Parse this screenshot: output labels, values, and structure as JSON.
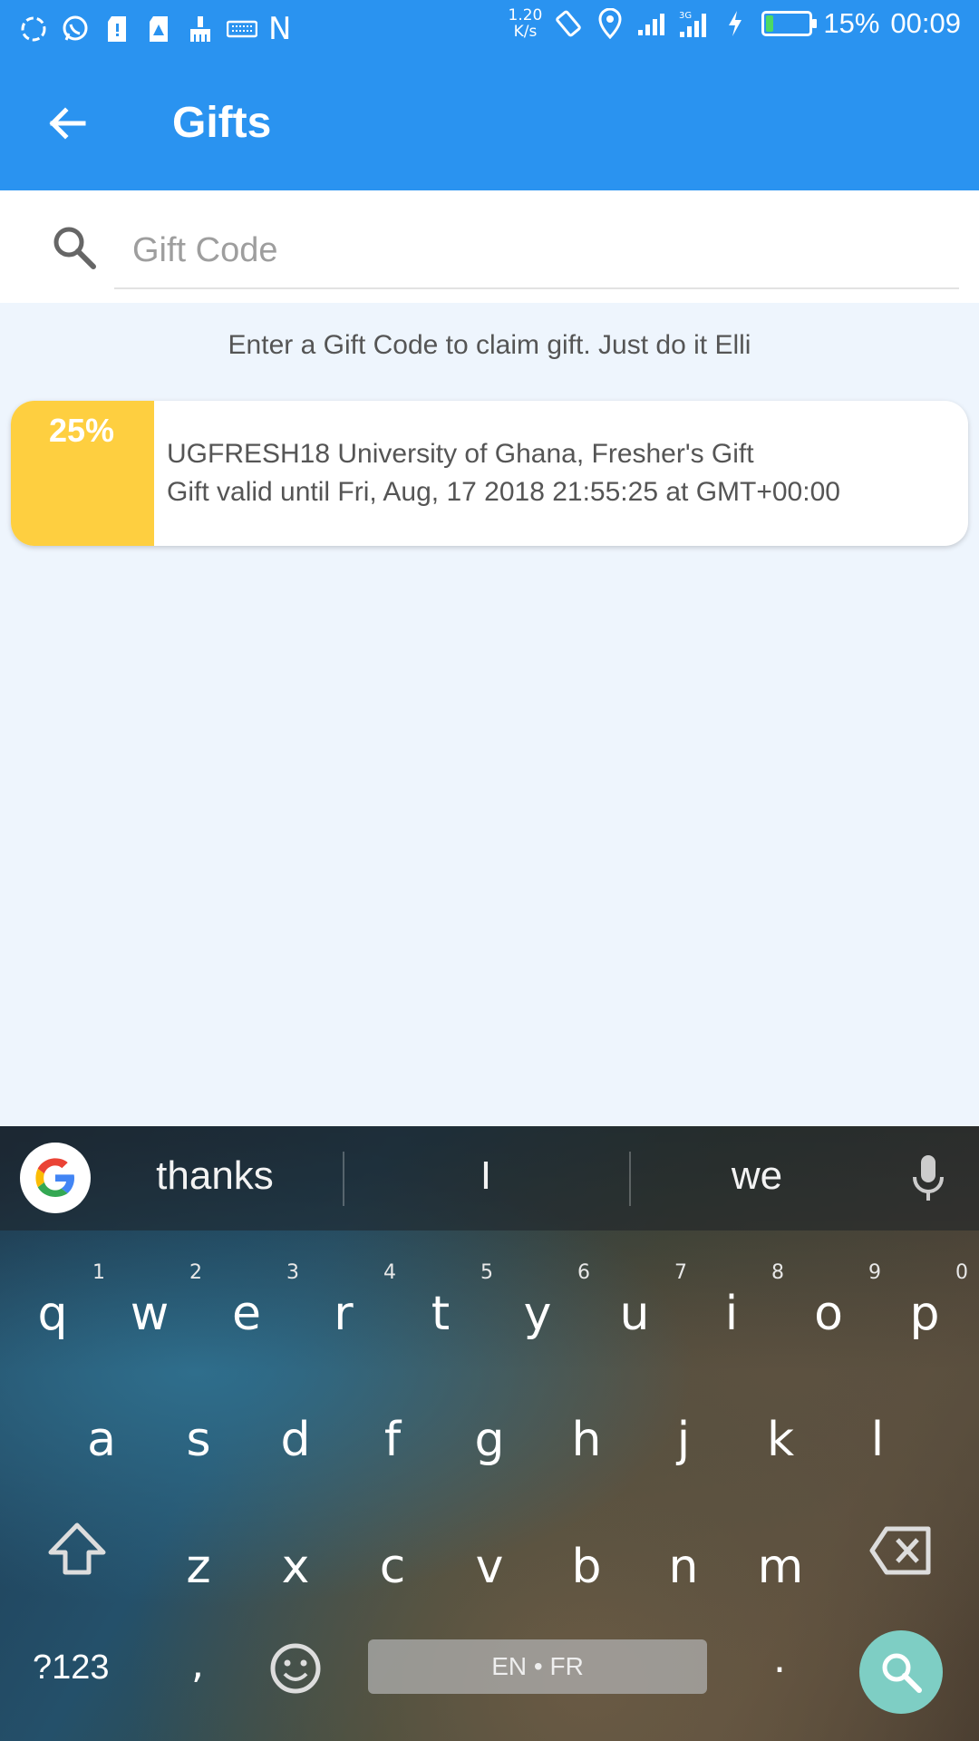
{
  "status_bar": {
    "network_speed_value": "1.20",
    "network_speed_unit": "K/s",
    "battery_percent": "15%",
    "battery_level": 0.15,
    "time": "00:09",
    "n_label": "N",
    "signal_label": "3G"
  },
  "app_bar": {
    "title": "Gifts"
  },
  "search": {
    "placeholder": "Gift Code",
    "value": ""
  },
  "hint": "Enter a Gift Code to claim gift. Just do it Elli",
  "gifts": [
    {
      "discount": "25%",
      "line1": "UGFRESH18 University of Ghana, Fresher's Gift",
      "line2": "Gift valid until Fri, Aug, 17 2018 21:55:25 at GMT+00:00"
    }
  ],
  "keyboard": {
    "suggestions": [
      "thanks",
      "I",
      "we"
    ],
    "row1": [
      "q",
      "w",
      "e",
      "r",
      "t",
      "y",
      "u",
      "i",
      "o",
      "p"
    ],
    "row1_numbers": [
      "1",
      "2",
      "3",
      "4",
      "5",
      "6",
      "7",
      "8",
      "9",
      "0"
    ],
    "row2": [
      "a",
      "s",
      "d",
      "f",
      "g",
      "h",
      "j",
      "k",
      "l"
    ],
    "row3": [
      "z",
      "x",
      "c",
      "v",
      "b",
      "n",
      "m"
    ],
    "symbols_label": "?123",
    "comma": ",",
    "period": ".",
    "space_label": "EN • FR"
  },
  "colors": {
    "primary": "#2a93f0",
    "badge": "#fecf40",
    "fab": "#7ecec4",
    "background": "#eef5fd"
  }
}
